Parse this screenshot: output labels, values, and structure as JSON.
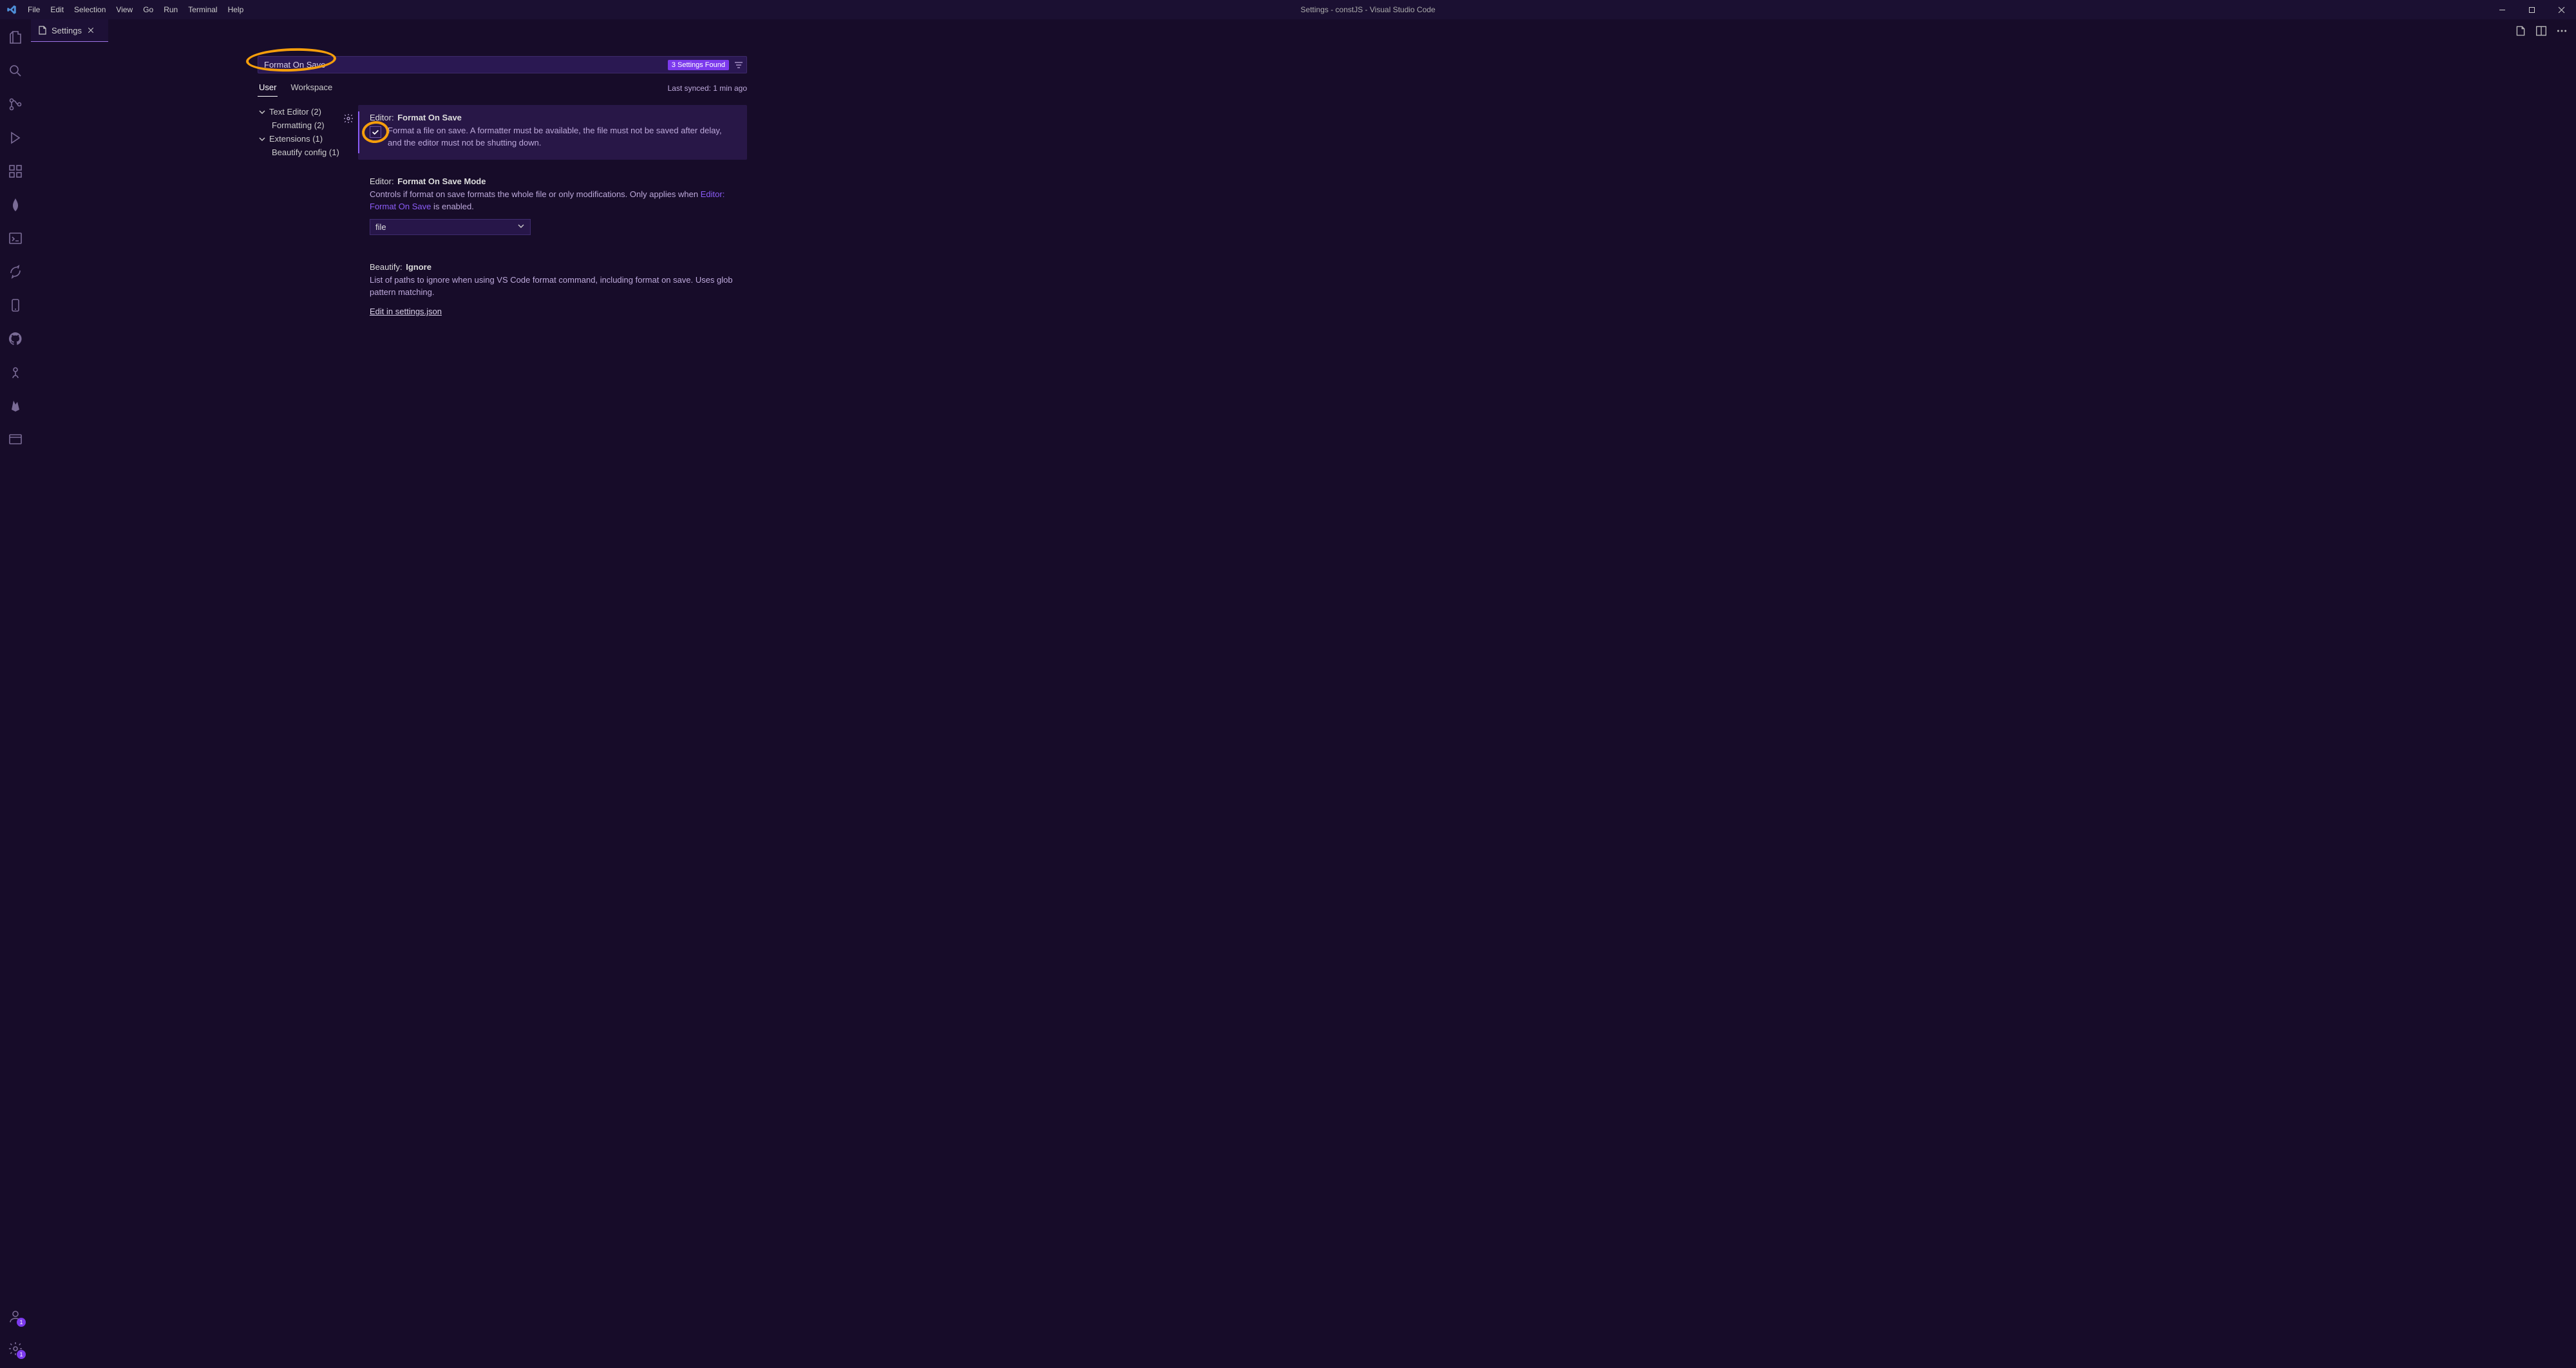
{
  "window": {
    "title": "Settings - constJS - Visual Studio Code"
  },
  "menu": {
    "file": "File",
    "edit": "Edit",
    "selection": "Selection",
    "view": "View",
    "go": "Go",
    "run": "Run",
    "terminal": "Terminal",
    "help": "Help"
  },
  "tab": {
    "label": "Settings"
  },
  "search": {
    "value": "Format On Save",
    "found_badge": "3 Settings Found"
  },
  "scope": {
    "user": "User",
    "workspace": "Workspace",
    "sync": "Last synced: 1 min ago"
  },
  "toc": {
    "text_editor": "Text Editor (2)",
    "formatting": "Formatting (2)",
    "extensions": "Extensions (1)",
    "beautify": "Beautify config (1)"
  },
  "settings": {
    "s1": {
      "scope": "Editor:",
      "name": "Format On Save",
      "desc": "Format a file on save. A formatter must be available, the file must not be saved after delay, and the editor must not be shutting down."
    },
    "s2": {
      "scope": "Editor:",
      "name": "Format On Save Mode",
      "desc_pre": "Controls if format on save formats the whole file or only modifications. Only applies when ",
      "desc_link": "Editor: Format On Save",
      "desc_post": " is enabled.",
      "select_value": "file"
    },
    "s3": {
      "scope": "Beautify:",
      "name": "Ignore",
      "desc": "List of paths to ignore when using VS Code format command, including format on save. Uses glob pattern matching.",
      "edit_link": "Edit in settings.json"
    }
  },
  "badges": {
    "accounts": "1",
    "manage": "1"
  }
}
